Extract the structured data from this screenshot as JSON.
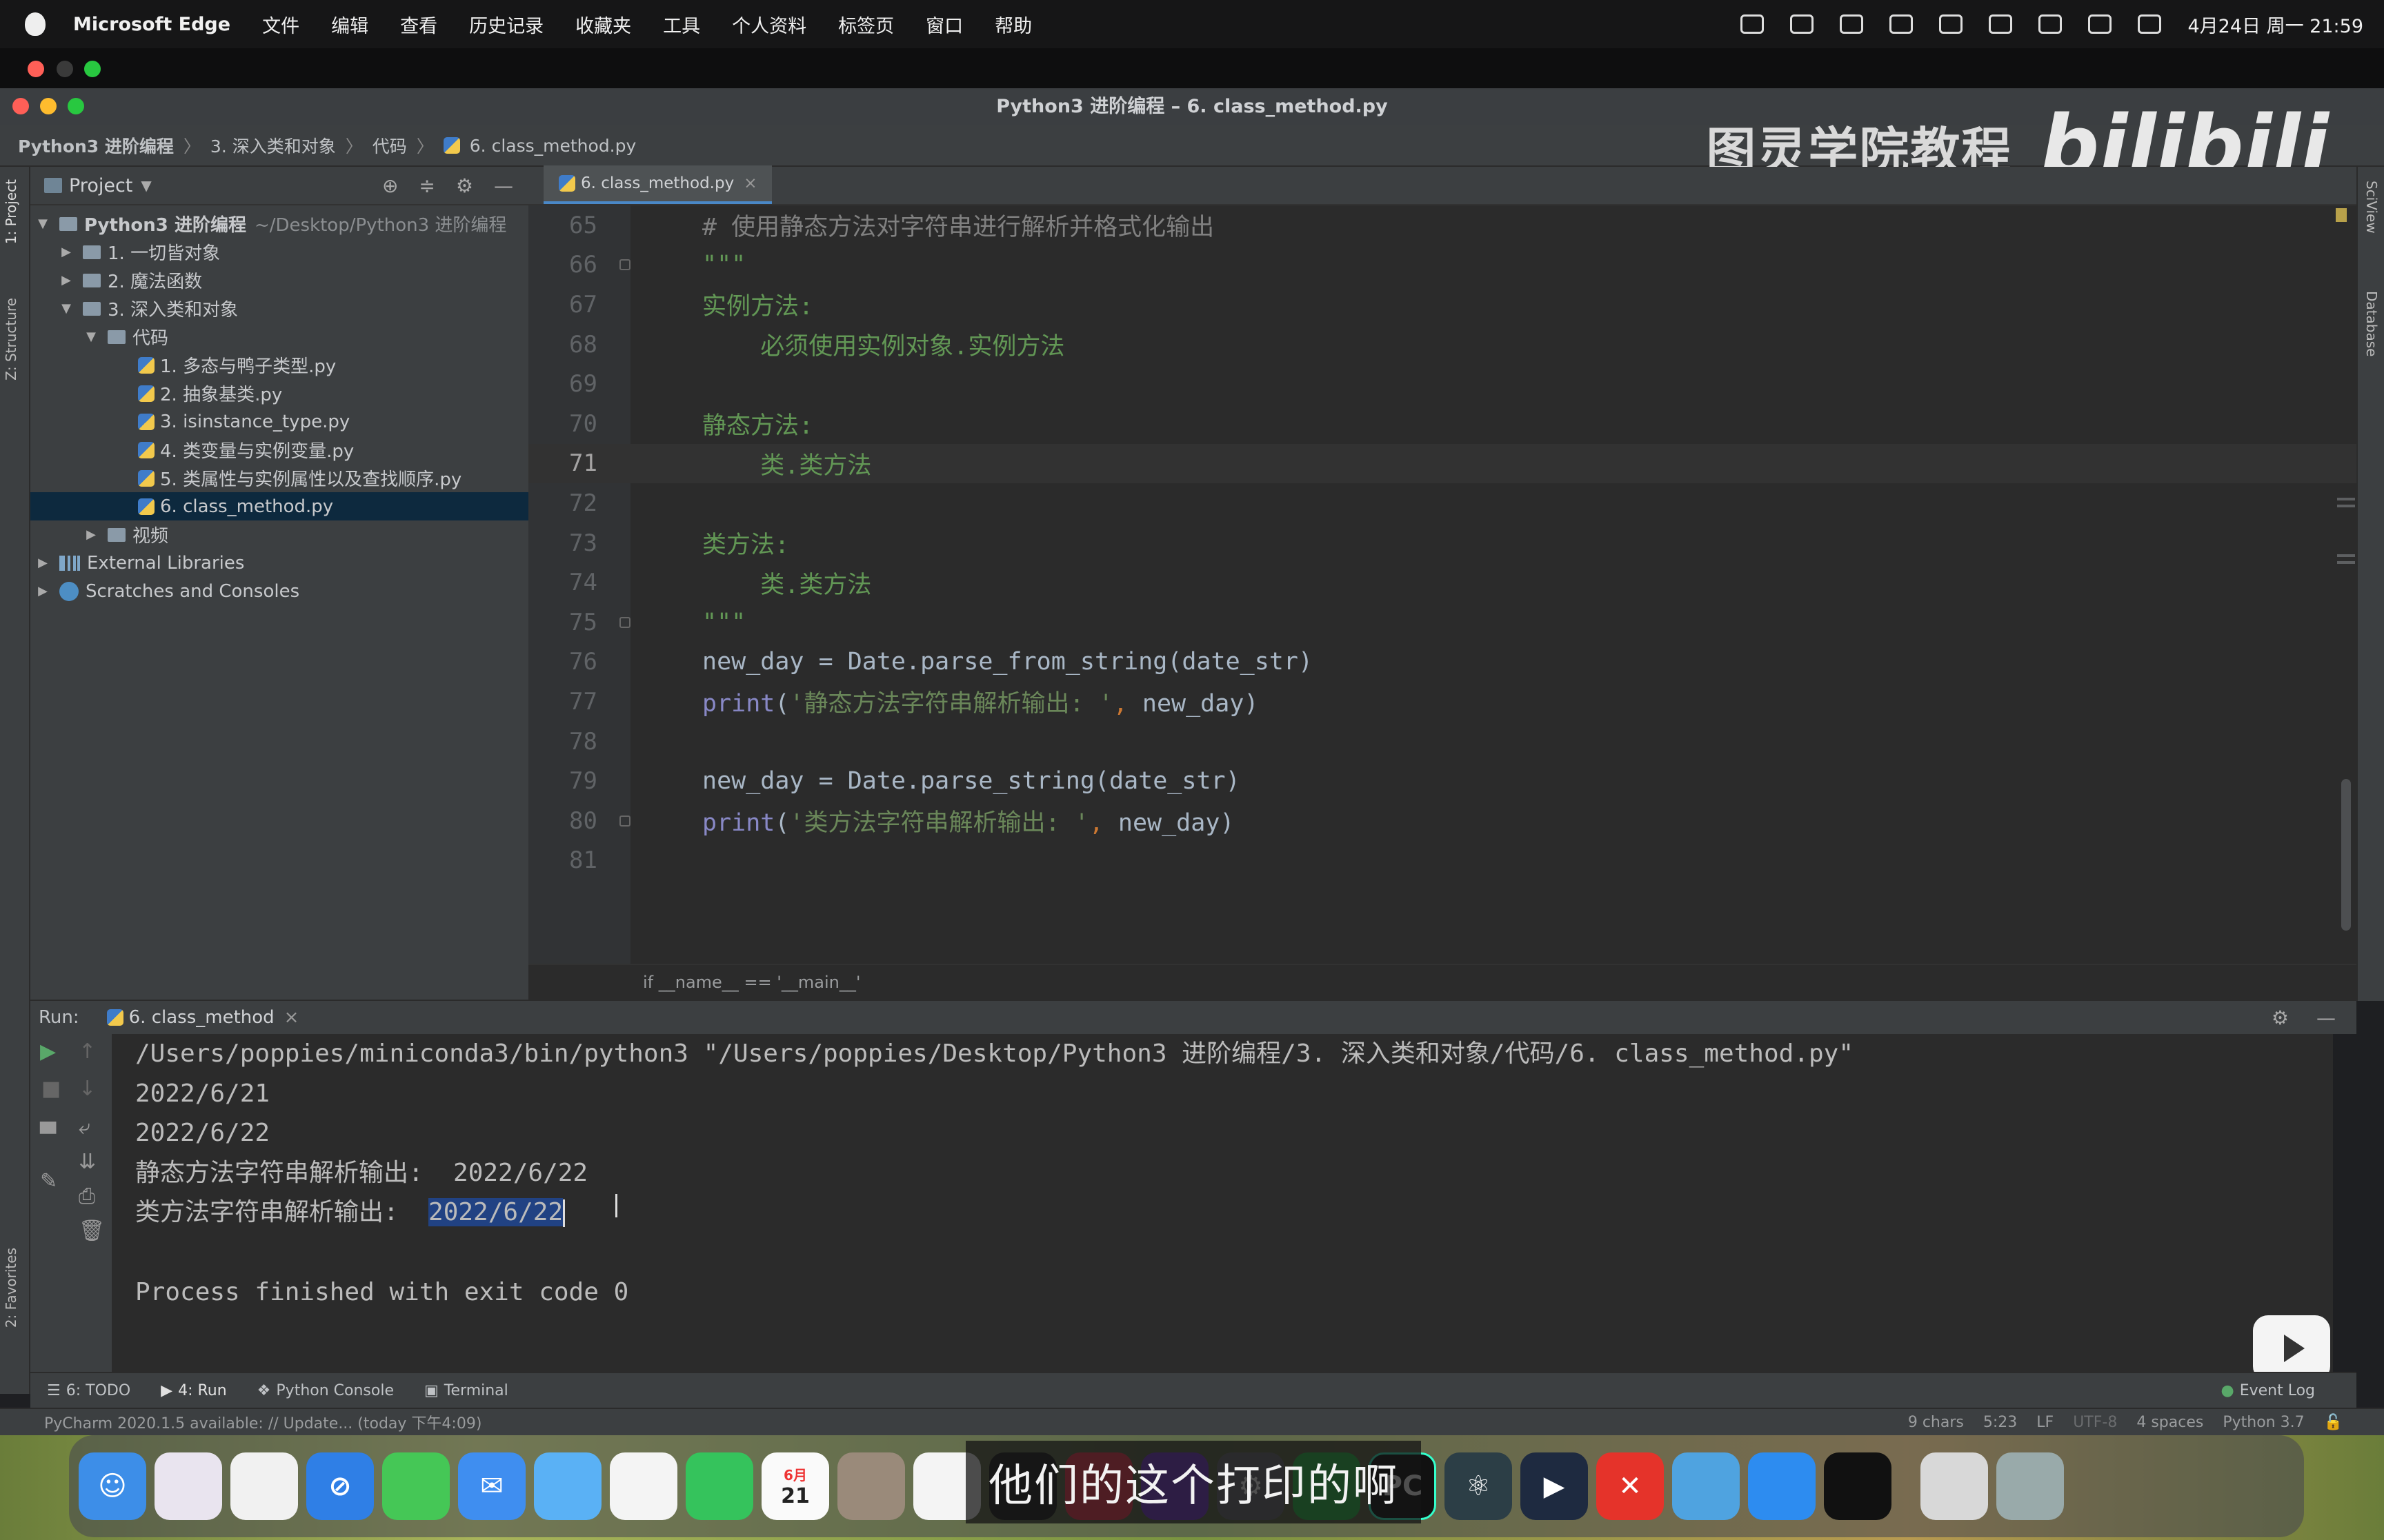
{
  "menubar": {
    "app_name": "Microsoft Edge",
    "items": [
      "文件",
      "编辑",
      "查看",
      "历史记录",
      "收藏夹",
      "工具",
      "个人资料",
      "标签页",
      "窗口",
      "帮助"
    ],
    "clock": "4月24日 周一  21:59"
  },
  "window": {
    "title": "Python3 进阶编程 – 6. class_method.py",
    "breadcrumb": [
      "Python3 进阶编程",
      "3. 深入类和对象",
      "代码",
      "6. class_method.py"
    ]
  },
  "watermark": {
    "text": "图灵学院教程",
    "logo": "bilibili"
  },
  "left_strip": {
    "project": "1: Project",
    "structure": "Z: Structure",
    "favorites": "2: Favorites"
  },
  "right_strip": {
    "sciview": "SciView",
    "database": "Database"
  },
  "project_panel": {
    "header": "Project",
    "root": {
      "name": "Python3 进阶编程",
      "path": "~/Desktop/Python3 进阶编程"
    },
    "folders": {
      "f1": "1. 一切皆对象",
      "f2": "2. 魔法函数",
      "f3": "3. 深入类和对象",
      "code": "代码",
      "video": "视频"
    },
    "files": [
      "1. 多态与鸭子类型.py",
      "2. 抽象基类.py",
      "3. isinstance_type.py",
      "4. 类变量与实例变量.py",
      "5. 类属性与实例属性以及查找顺序.py",
      "6. class_method.py"
    ],
    "external": "External Libraries",
    "scratches": "Scratches and Consoles"
  },
  "editor": {
    "tab": "6. class_method.py",
    "lines": {
      "n65": "65",
      "n66": "66",
      "n67": "67",
      "n68": "68",
      "n69": "69",
      "n70": "70",
      "n71": "71",
      "n72": "72",
      "n73": "73",
      "n74": "74",
      "n75": "75",
      "n76": "76",
      "n77": "77",
      "n78": "78",
      "n79": "79",
      "n80": "80",
      "n81": "81"
    },
    "code": {
      "l65": "# 使用静态方法对字符串进行解析并格式化输出",
      "l66": "\"\"\"",
      "l67": "实例方法:",
      "l68": "    必须使用实例对象.实例方法",
      "l70": "静态方法:",
      "l71": "    类.类方法",
      "l73": "类方法:",
      "l74": "    类.类方法",
      "l75": "\"\"\"",
      "l76": "new_day = Date.parse_from_string(date_str)",
      "l77_fn": "print",
      "l77_open": "(",
      "l77_str": "'静态方法字符串解析输出: '",
      "l77_comma": ", ",
      "l77_rest": "new_day)",
      "l79": "new_day = Date.parse_string(date_str)",
      "l80_fn": "print",
      "l80_open": "(",
      "l80_str": "'类方法字符串解析输出: '",
      "l80_comma": ", ",
      "l80_rest": "new_day)"
    },
    "bottom_breadcrumb": "if __name__ == '__main__'"
  },
  "run": {
    "label": "Run:",
    "tab": "6. class_method",
    "output": {
      "cmd": "/Users/poppies/miniconda3/bin/python3 \"/Users/poppies/Desktop/Python3 进阶编程/3. 深入类和对象/代码/6. class_method.py\"",
      "o1": "2022/6/21",
      "o2": "2022/6/22",
      "o3": "静态方法字符串解析输出:  2022/6/22",
      "o4_prefix": "类方法字符串解析输出:  ",
      "o4_selected": "2022/6/22",
      "exit": "Process finished with exit code 0"
    }
  },
  "bottom_tabs": {
    "todo": "6: TODO",
    "run": "4: Run",
    "console": "Python Console",
    "terminal": "Terminal",
    "eventlog": "Event Log"
  },
  "status": {
    "message": "PyCharm 2020.1.5 available: // Update... (today 下午4:09)",
    "chars": "9 chars",
    "pos": "5:23",
    "eol": "LF",
    "encoding": "UTF-8",
    "indent": "4 spaces",
    "interpreter": "Python 3.7"
  },
  "dock": {
    "calendar_month": "6月",
    "calendar_day": "21"
  },
  "subtitle": "他们的这个打印的啊",
  "colors": {
    "selection": "#214283",
    "tree_selected": "#0d293e",
    "comment": "#808080",
    "docstring": "#629755",
    "string": "#6a8759",
    "keyword": "#cc7832",
    "builtin": "#8888c6"
  }
}
